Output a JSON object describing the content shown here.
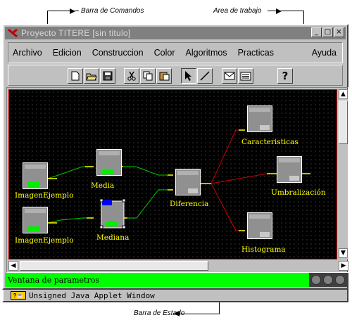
{
  "annotations": {
    "command_bar": "Barra de Comandos",
    "work_area": "Area de trabajo",
    "status_bar": "Barra de Estado"
  },
  "window": {
    "title": "Proyecto TITERE [sin titulo]",
    "controls": [
      "minimize",
      "maximize",
      "close"
    ]
  },
  "menu": {
    "items": [
      "Archivo",
      "Edicion",
      "Construccion",
      "Color",
      "Algoritmos",
      "Practicas",
      "Ayuda"
    ]
  },
  "toolbar": {
    "buttons": [
      "new-icon",
      "open-icon",
      "save-icon",
      "cut-icon",
      "copy-icon",
      "paste-icon",
      "select-arrow-icon",
      "line-icon",
      "mail-icon",
      "list-icon",
      "help-icon"
    ],
    "help_label": "?",
    "selected_tool": "select-arrow-icon"
  },
  "canvas": {
    "nodes": [
      {
        "id": "img1",
        "label": "ImagenEjemplo",
        "indicator": "green"
      },
      {
        "id": "img2",
        "label": "ImagenEjemplo",
        "indicator": "green"
      },
      {
        "id": "media",
        "label": "Media",
        "indicator": "green"
      },
      {
        "id": "mediana",
        "label": "Mediana",
        "indicator": "green",
        "selected": true
      },
      {
        "id": "diferencia",
        "label": "Diferencia",
        "indicator": "none"
      },
      {
        "id": "caracteristicas",
        "label": "Caracteristicas",
        "indicator": "none"
      },
      {
        "id": "umbralizacion",
        "label": "Umbralización",
        "indicator": "none"
      },
      {
        "id": "histograma",
        "label": "Histograma",
        "indicator": "none"
      }
    ],
    "colors": {
      "background": "#000000",
      "border": "#c00000",
      "link_input": "#00cc00",
      "link_output": "#cc0000",
      "port": "#ffff00",
      "label": "#ffff00"
    }
  },
  "status": {
    "text": "Ventana de parametros",
    "color": "#00ff00"
  },
  "applet_warning": {
    "text": "Unsigned Java Applet Window"
  }
}
